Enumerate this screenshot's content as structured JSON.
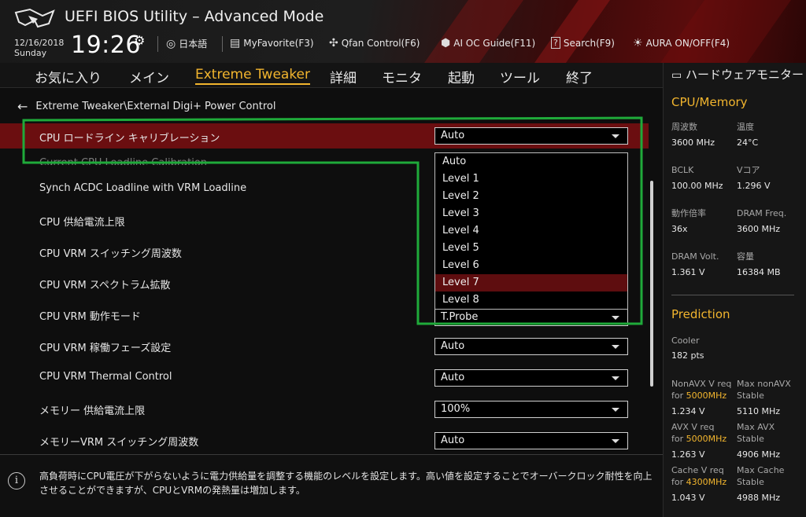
{
  "header": {
    "title": "UEFI BIOS Utility – Advanced Mode",
    "date": "12/16/2018",
    "day": "Sunday",
    "time": "19:26",
    "tools": {
      "language": "日本語",
      "favorite": "MyFavorite(F3)",
      "qfan": "Qfan Control(F6)",
      "ai_guide": "AI OC Guide(F11)",
      "search": "Search(F9)",
      "aura": "AURA ON/OFF(F4)"
    }
  },
  "nav": {
    "tabs": [
      "お気に入り",
      "メイン",
      "Extreme Tweaker",
      "詳細",
      "モニタ",
      "起動",
      "ツール",
      "終了"
    ],
    "active": "Extreme Tweaker"
  },
  "breadcrumb": "Extreme Tweaker\\External Digi+ Power Control",
  "settings": [
    {
      "label": "CPU ロードライン キャリブレーション",
      "value": "Auto"
    },
    {
      "label": "Current CPU Loadline Calibration",
      "value": ""
    },
    {
      "label": "Synch ACDC Loadline with VRM Loadline",
      "value": ""
    },
    {
      "label": "CPU 供給電流上限",
      "value": ""
    },
    {
      "label": "CPU VRM スイッチング周波数",
      "value": ""
    },
    {
      "label": "CPU VRM スペクトラム拡散",
      "value": ""
    },
    {
      "label": "CPU VRM 動作モード",
      "value": "T.Probe"
    },
    {
      "label": "CPU VRM 稼働フェーズ設定",
      "value": "Auto"
    },
    {
      "label": "CPU VRM Thermal Control",
      "value": "Auto"
    },
    {
      "label": "メモリー 供給電流上限",
      "value": "100%"
    },
    {
      "label": "メモリーVRM スイッチング周波数",
      "value": "Auto"
    }
  ],
  "dropdown": {
    "options": [
      "Auto",
      "Level 1",
      "Level 2",
      "Level 3",
      "Level 4",
      "Level 5",
      "Level 6",
      "Level 7",
      "Level 8"
    ],
    "highlighted": "Level 7"
  },
  "help_text": "高負荷時にCPU電圧が下がらないように電力供給量を調整する機能のレベルを設定します。高い値を設定することでオーバークロック耐性を向上させることができますが、CPUとVRMの発熱量は増加します。",
  "monitor": {
    "title": "ハードウェアモニター",
    "cpu_section": "CPU/Memory",
    "cpu_items": [
      {
        "label": "周波数",
        "value": "3600 MHz"
      },
      {
        "label": "温度",
        "value": "24°C"
      },
      {
        "label": "BCLK",
        "value": "100.00 MHz"
      },
      {
        "label": "Vコア",
        "value": "1.296 V"
      },
      {
        "label": "動作倍率",
        "value": "36x"
      },
      {
        "label": "DRAM Freq.",
        "value": "3600 MHz"
      },
      {
        "label": "DRAM Volt.",
        "value": "1.361 V"
      },
      {
        "label": "容量",
        "value": "16384 MB"
      }
    ],
    "prediction_section": "Prediction",
    "cooler_label": "Cooler",
    "cooler_value": "182 pts",
    "prediction_items": [
      {
        "label1": "NonAVX V req",
        "label2_prefix": "for ",
        "label2_hl": "5000MHz",
        "value": "1.234 V"
      },
      {
        "label1": "Max nonAVX",
        "label2_prefix": "Stable",
        "label2_hl": "",
        "value": "5110 MHz"
      },
      {
        "label1": "AVX V req",
        "label2_prefix": "for ",
        "label2_hl": "5000MHz",
        "value": "1.263 V"
      },
      {
        "label1": "Max AVX",
        "label2_prefix": "Stable",
        "label2_hl": "",
        "value": "4906 MHz"
      },
      {
        "label1": "Cache V req",
        "label2_prefix": "for ",
        "label2_hl": "4300MHz",
        "value": "1.043 V"
      },
      {
        "label1": "Max Cache",
        "label2_prefix": "Stable",
        "label2_hl": "",
        "value": "4988 MHz"
      }
    ]
  },
  "colors": {
    "accent": "#f2b52e",
    "selected_row": "#6b0e10",
    "annotation": "#1faa3a"
  }
}
